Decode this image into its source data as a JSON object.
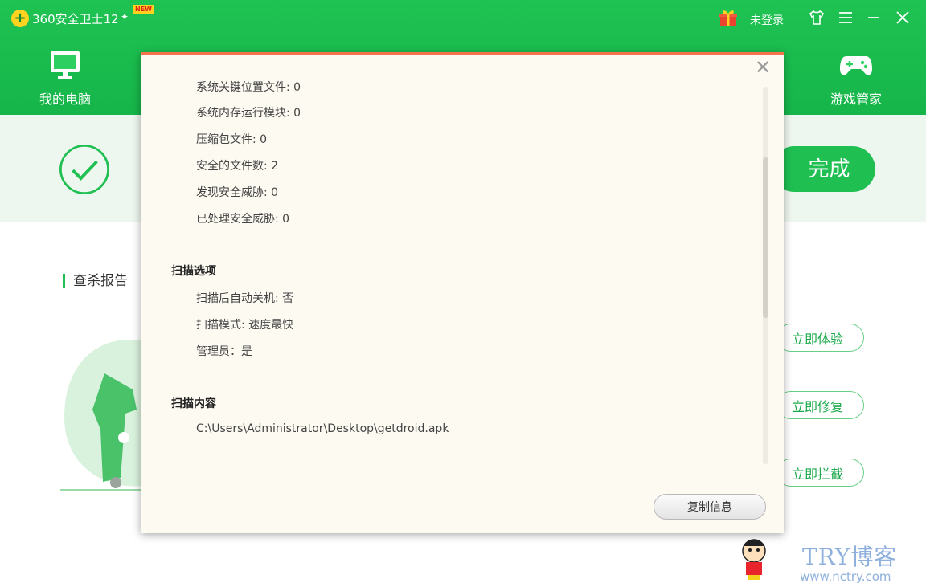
{
  "window": {
    "title": "360安全卫士12",
    "badge": "NEW",
    "login": "未登录"
  },
  "nav": {
    "my_pc": "我的电脑",
    "game_manager": "游戏管家"
  },
  "background": {
    "done_label": "完成",
    "report_title": "查杀报告",
    "actions": [
      "立即体验",
      "立即修复",
      "立即拦截"
    ]
  },
  "dialog": {
    "stats": [
      "系统关键位置文件: 0",
      "系统内存运行模块: 0",
      "压缩包文件: 0",
      "安全的文件数: 2",
      "发现安全威胁: 0",
      "已处理安全威胁: 0"
    ],
    "options_title": "扫描选项",
    "options": [
      "扫描后自动关机: 否",
      "扫描模式: 速度最快",
      "管理员：是"
    ],
    "content_title": "扫描内容",
    "content_path": "C:\\Users\\Administrator\\Desktop\\getdroid.apk",
    "copy_button": "复制信息",
    "close_symbol": "✕"
  },
  "watermark": {
    "title": "TRY博客",
    "url": "www.nctry.com"
  },
  "colors": {
    "brand_green": "#1fbf52",
    "dialog_bg": "#fdfaf2",
    "dialog_accent": "#f4734d"
  }
}
